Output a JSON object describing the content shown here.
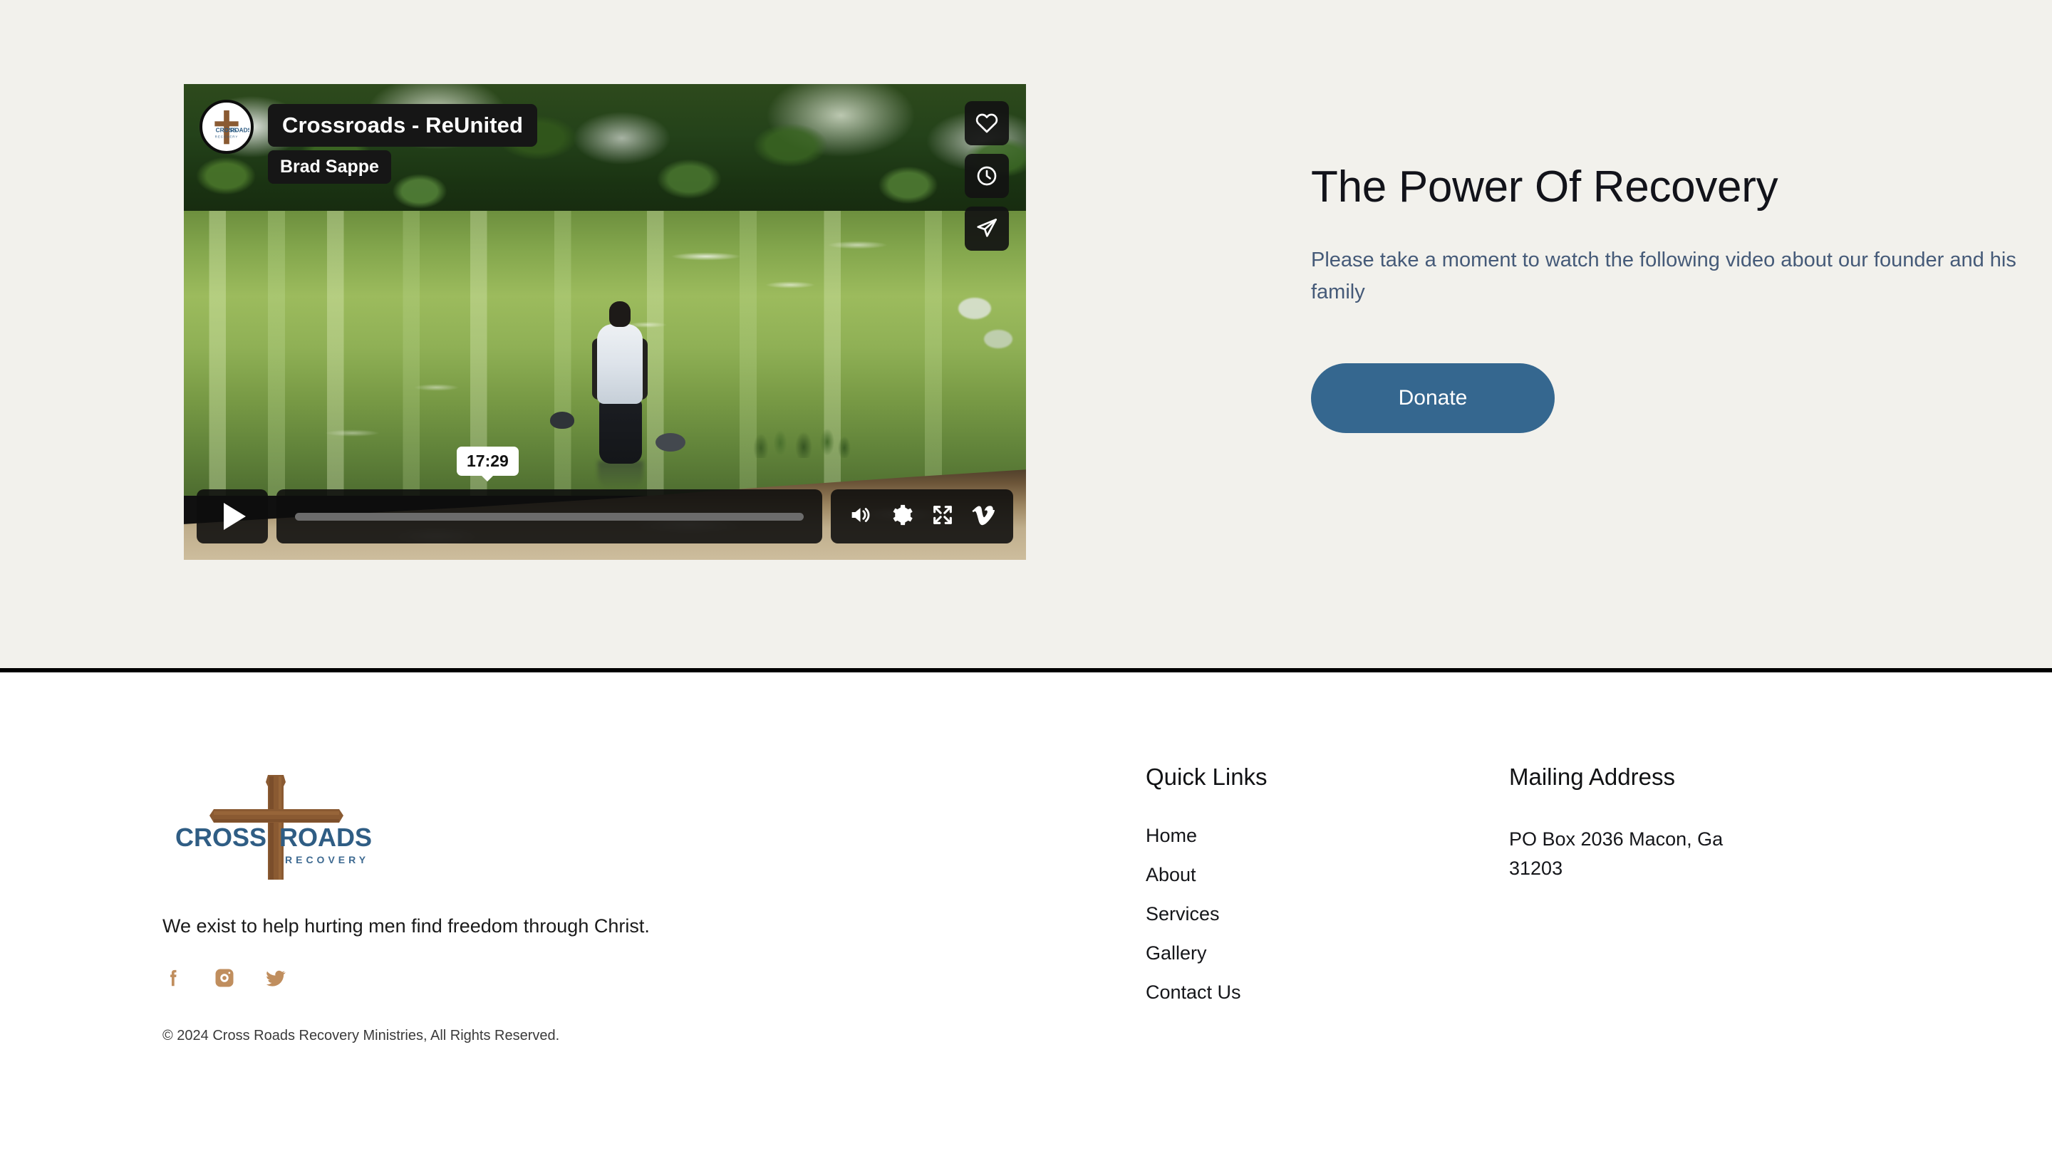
{
  "colors": {
    "hero_background": "#f2f1ec",
    "footer_background": "#ffffff",
    "divider": "#000000",
    "donate_button": "#35678f",
    "subtitle_text": "#455a78",
    "social_icon": "#c08e5e",
    "logo_blue": "#2f5d84",
    "logo_wood": "#8a5a32"
  },
  "hero": {
    "title": "The Power Of Recovery",
    "subtitle": "Please take a moment to watch the following video about our founder and his family",
    "donate_label": "Donate"
  },
  "video": {
    "title": "Crossroads - ReUnited",
    "author": "Brad Sappe",
    "duration": "17:29",
    "progress_percent": 0,
    "avatar_name": "crossroads-recovery-logo",
    "actions": [
      {
        "name": "like-button",
        "icon": "heart-icon"
      },
      {
        "name": "watch-later-button",
        "icon": "clock-icon"
      },
      {
        "name": "share-button",
        "icon": "paper-plane-icon"
      }
    ],
    "controls": [
      {
        "name": "play-button",
        "icon": "play-icon"
      },
      {
        "name": "volume-button",
        "icon": "volume-icon"
      },
      {
        "name": "settings-button",
        "icon": "gear-icon"
      },
      {
        "name": "fullscreen-button",
        "icon": "fullscreen-icon"
      },
      {
        "name": "vimeo-logo",
        "icon": "vimeo-icon"
      }
    ]
  },
  "footer": {
    "logo_primary": "CROSS",
    "logo_secondary": "ROADS",
    "logo_subtext": "RECOVERY",
    "tagline": "We exist to help hurting men find freedom through Christ.",
    "copyright": "© 2024 Cross Roads Recovery Ministries, All Rights Reserved.",
    "social": [
      {
        "name": "facebook-icon",
        "label": "Facebook"
      },
      {
        "name": "instagram-icon",
        "label": "Instagram"
      },
      {
        "name": "twitter-icon",
        "label": "Twitter"
      }
    ],
    "quick_links": {
      "heading": "Quick Links",
      "items": [
        {
          "label": "Home"
        },
        {
          "label": "About"
        },
        {
          "label": "Services"
        },
        {
          "label": "Gallery"
        },
        {
          "label": "Contact Us"
        }
      ]
    },
    "mailing_address": {
      "heading": "Mailing Address",
      "text": "PO Box 2036 Macon, Ga 31203"
    }
  }
}
